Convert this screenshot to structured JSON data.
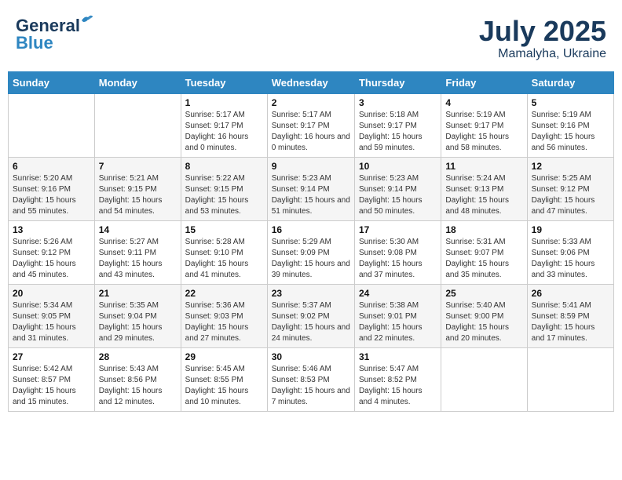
{
  "logo": {
    "line1": "General",
    "line2": "Blue"
  },
  "title": "July 2025",
  "location": "Mamalyha, Ukraine",
  "days_of_week": [
    "Sunday",
    "Monday",
    "Tuesday",
    "Wednesday",
    "Thursday",
    "Friday",
    "Saturday"
  ],
  "weeks": [
    [
      {
        "day": "",
        "info": ""
      },
      {
        "day": "",
        "info": ""
      },
      {
        "day": "1",
        "info": "Sunrise: 5:17 AM\nSunset: 9:17 PM\nDaylight: 16 hours and 0 minutes."
      },
      {
        "day": "2",
        "info": "Sunrise: 5:17 AM\nSunset: 9:17 PM\nDaylight: 16 hours and 0 minutes."
      },
      {
        "day": "3",
        "info": "Sunrise: 5:18 AM\nSunset: 9:17 PM\nDaylight: 15 hours and 59 minutes."
      },
      {
        "day": "4",
        "info": "Sunrise: 5:19 AM\nSunset: 9:17 PM\nDaylight: 15 hours and 58 minutes."
      },
      {
        "day": "5",
        "info": "Sunrise: 5:19 AM\nSunset: 9:16 PM\nDaylight: 15 hours and 56 minutes."
      }
    ],
    [
      {
        "day": "6",
        "info": "Sunrise: 5:20 AM\nSunset: 9:16 PM\nDaylight: 15 hours and 55 minutes."
      },
      {
        "day": "7",
        "info": "Sunrise: 5:21 AM\nSunset: 9:15 PM\nDaylight: 15 hours and 54 minutes."
      },
      {
        "day": "8",
        "info": "Sunrise: 5:22 AM\nSunset: 9:15 PM\nDaylight: 15 hours and 53 minutes."
      },
      {
        "day": "9",
        "info": "Sunrise: 5:23 AM\nSunset: 9:14 PM\nDaylight: 15 hours and 51 minutes."
      },
      {
        "day": "10",
        "info": "Sunrise: 5:23 AM\nSunset: 9:14 PM\nDaylight: 15 hours and 50 minutes."
      },
      {
        "day": "11",
        "info": "Sunrise: 5:24 AM\nSunset: 9:13 PM\nDaylight: 15 hours and 48 minutes."
      },
      {
        "day": "12",
        "info": "Sunrise: 5:25 AM\nSunset: 9:12 PM\nDaylight: 15 hours and 47 minutes."
      }
    ],
    [
      {
        "day": "13",
        "info": "Sunrise: 5:26 AM\nSunset: 9:12 PM\nDaylight: 15 hours and 45 minutes."
      },
      {
        "day": "14",
        "info": "Sunrise: 5:27 AM\nSunset: 9:11 PM\nDaylight: 15 hours and 43 minutes."
      },
      {
        "day": "15",
        "info": "Sunrise: 5:28 AM\nSunset: 9:10 PM\nDaylight: 15 hours and 41 minutes."
      },
      {
        "day": "16",
        "info": "Sunrise: 5:29 AM\nSunset: 9:09 PM\nDaylight: 15 hours and 39 minutes."
      },
      {
        "day": "17",
        "info": "Sunrise: 5:30 AM\nSunset: 9:08 PM\nDaylight: 15 hours and 37 minutes."
      },
      {
        "day": "18",
        "info": "Sunrise: 5:31 AM\nSunset: 9:07 PM\nDaylight: 15 hours and 35 minutes."
      },
      {
        "day": "19",
        "info": "Sunrise: 5:33 AM\nSunset: 9:06 PM\nDaylight: 15 hours and 33 minutes."
      }
    ],
    [
      {
        "day": "20",
        "info": "Sunrise: 5:34 AM\nSunset: 9:05 PM\nDaylight: 15 hours and 31 minutes."
      },
      {
        "day": "21",
        "info": "Sunrise: 5:35 AM\nSunset: 9:04 PM\nDaylight: 15 hours and 29 minutes."
      },
      {
        "day": "22",
        "info": "Sunrise: 5:36 AM\nSunset: 9:03 PM\nDaylight: 15 hours and 27 minutes."
      },
      {
        "day": "23",
        "info": "Sunrise: 5:37 AM\nSunset: 9:02 PM\nDaylight: 15 hours and 24 minutes."
      },
      {
        "day": "24",
        "info": "Sunrise: 5:38 AM\nSunset: 9:01 PM\nDaylight: 15 hours and 22 minutes."
      },
      {
        "day": "25",
        "info": "Sunrise: 5:40 AM\nSunset: 9:00 PM\nDaylight: 15 hours and 20 minutes."
      },
      {
        "day": "26",
        "info": "Sunrise: 5:41 AM\nSunset: 8:59 PM\nDaylight: 15 hours and 17 minutes."
      }
    ],
    [
      {
        "day": "27",
        "info": "Sunrise: 5:42 AM\nSunset: 8:57 PM\nDaylight: 15 hours and 15 minutes."
      },
      {
        "day": "28",
        "info": "Sunrise: 5:43 AM\nSunset: 8:56 PM\nDaylight: 15 hours and 12 minutes."
      },
      {
        "day": "29",
        "info": "Sunrise: 5:45 AM\nSunset: 8:55 PM\nDaylight: 15 hours and 10 minutes."
      },
      {
        "day": "30",
        "info": "Sunrise: 5:46 AM\nSunset: 8:53 PM\nDaylight: 15 hours and 7 minutes."
      },
      {
        "day": "31",
        "info": "Sunrise: 5:47 AM\nSunset: 8:52 PM\nDaylight: 15 hours and 4 minutes."
      },
      {
        "day": "",
        "info": ""
      },
      {
        "day": "",
        "info": ""
      }
    ]
  ]
}
